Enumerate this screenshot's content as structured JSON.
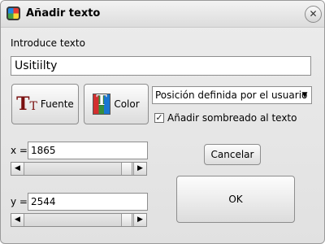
{
  "window": {
    "title": "Añadir texto",
    "close_glyph": "⊗"
  },
  "text_section": {
    "label": "Introduce texto",
    "value": "Usitiilty"
  },
  "buttons": {
    "font_label": "Fuente",
    "font_icon": "font-style-icon",
    "color_label": "Color",
    "color_icon": "text-color-icon",
    "cancel_label": "Cancelar",
    "ok_label": "OK"
  },
  "position_select": {
    "selected": "Posición definida por el usuario"
  },
  "shadow_checkbox": {
    "label": "Añadir sombreado al texto",
    "checked": true
  },
  "x_field": {
    "label": "x =",
    "value": "1865"
  },
  "y_field": {
    "label": "y =",
    "value": "2544"
  }
}
